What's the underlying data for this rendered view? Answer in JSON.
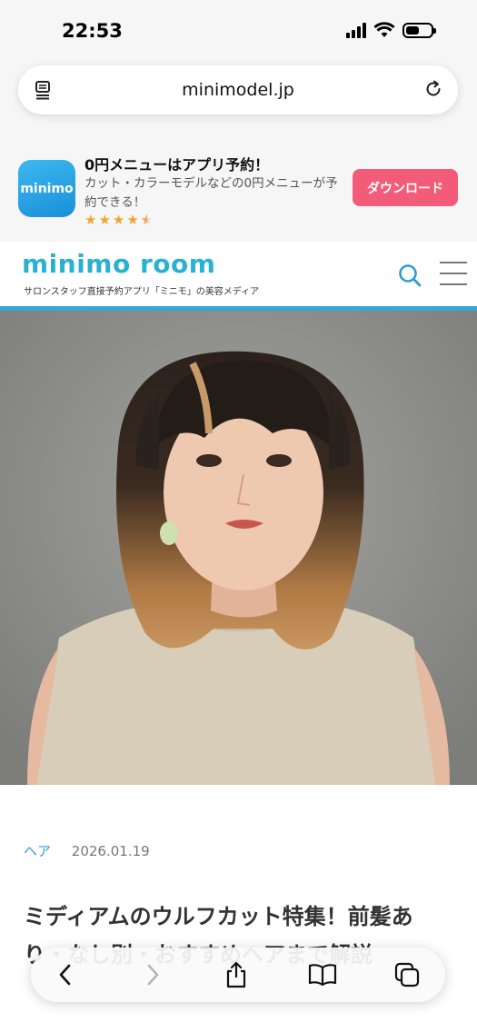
{
  "status_bar": {
    "time": "22:53"
  },
  "browser": {
    "url": "minimodel.jp"
  },
  "app_banner": {
    "icon_text": "minimo",
    "title": "0円メニューはアプリ予約！",
    "description": "カット・カラーモデルなどの0円メニューが予約できる！",
    "rating": "4.5 of 5 stars",
    "download_label": "ダウンロード"
  },
  "site_header": {
    "logo": "minimo room",
    "tagline": "サロンスタッフ直接予約アプリ「ミニモ」の美容メディア"
  },
  "article": {
    "category": "ヘア",
    "date": "2026.01.19",
    "title": "ミディアムのウルフカット特集！前髪あり・なし別・おすすめヘアまで解説"
  },
  "colors": {
    "accent_blue": "#2ab1d1",
    "download_pink": "#f25c78",
    "star_orange": "#f2a233"
  }
}
